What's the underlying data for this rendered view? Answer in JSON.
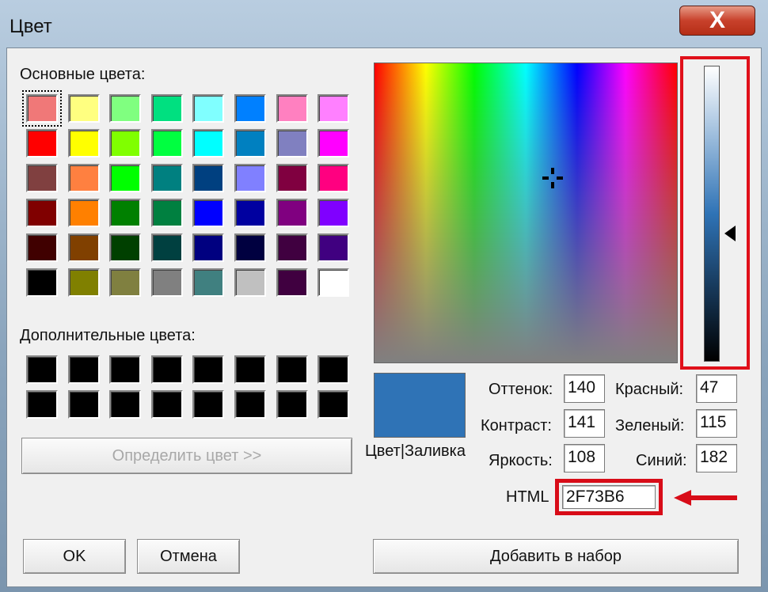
{
  "window": {
    "title": "Цвет",
    "close_label": "X"
  },
  "basic_colors": {
    "label": "Основные цвета:",
    "rows": [
      [
        "#f07878",
        "#ffff80",
        "#80ff80",
        "#00e080",
        "#80ffff",
        "#0080ff",
        "#ff80c0",
        "#ff80ff"
      ],
      [
        "#ff0000",
        "#ffff00",
        "#80ff00",
        "#00ff40",
        "#00ffff",
        "#0080c0",
        "#8080c0",
        "#ff00ff"
      ],
      [
        "#804040",
        "#ff8040",
        "#00ff00",
        "#008080",
        "#004080",
        "#8080ff",
        "#800040",
        "#ff0080"
      ],
      [
        "#800000",
        "#ff8000",
        "#008000",
        "#008040",
        "#0000ff",
        "#0000a0",
        "#800080",
        "#8000ff"
      ],
      [
        "#400000",
        "#804000",
        "#004000",
        "#004040",
        "#000080",
        "#000040",
        "#400040",
        "#400080"
      ],
      [
        "#000000",
        "#808000",
        "#808040",
        "#808080",
        "#408080",
        "#c0c0c0",
        "#400040",
        "#ffffff"
      ]
    ]
  },
  "custom_colors": {
    "label": "Дополнительные цвета:",
    "rows": [
      [
        "#000000",
        "#000000",
        "#000000",
        "#000000",
        "#000000",
        "#000000",
        "#000000",
        "#000000"
      ],
      [
        "#000000",
        "#000000",
        "#000000",
        "#000000",
        "#000000",
        "#000000",
        "#000000",
        "#000000"
      ]
    ]
  },
  "define_button": "Определить цвет >>",
  "ok_button": "OK",
  "cancel_button": "Отмена",
  "add_button": "Добавить в набор",
  "preview": {
    "label": "Цвет|Заливка",
    "color": "#2f73b6"
  },
  "fields": {
    "hue": {
      "label": "Оттенок:",
      "value": "140"
    },
    "sat": {
      "label": "Контраст:",
      "value": "141"
    },
    "lum": {
      "label": "Яркость:",
      "value": "108"
    },
    "red": {
      "label": "Красный:",
      "value": "47"
    },
    "green": {
      "label": "Зеленый:",
      "value": "115"
    },
    "blue": {
      "label": "Синий:",
      "value": "182"
    },
    "html": {
      "label": "HTML",
      "value": "2F73B6"
    }
  },
  "highlight_color": "#d80c18"
}
